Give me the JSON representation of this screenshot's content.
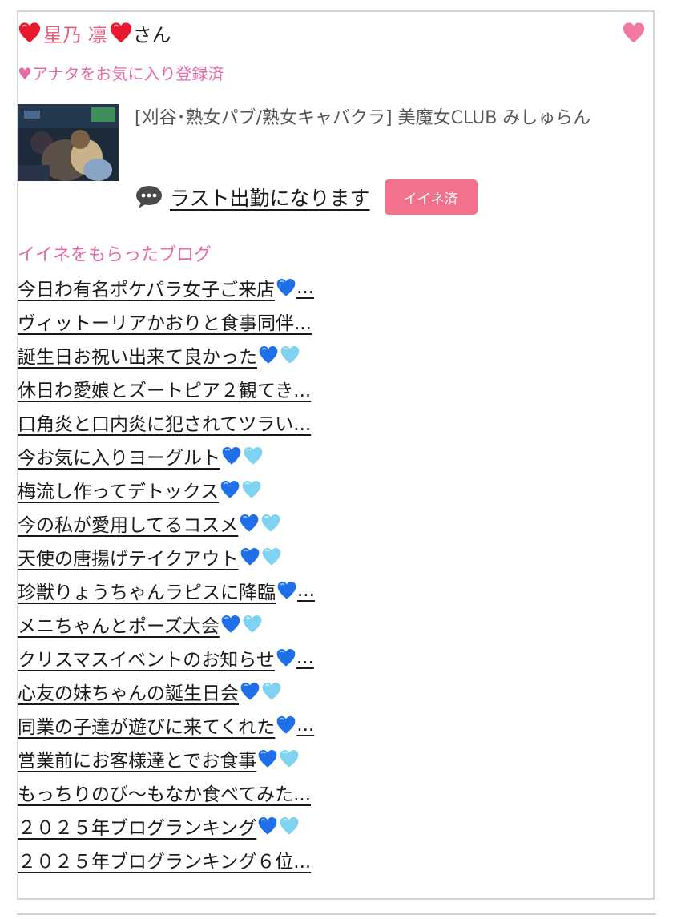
{
  "profile": {
    "name": "星乃 凛",
    "suffix": "さん",
    "favorite_status": "♥アナタをお気に入り登録済",
    "shop": "[刈谷･熟女パブ/熟女キャバクラ]  美魔女CLUB みしゅらん",
    "status_text": "ラスト出勤になります",
    "like_badge": "イイネ済"
  },
  "icons": {
    "name_heart": "red-heart-icon",
    "favorite": "pink-heart-icon",
    "comment": "speech-bubble-icon",
    "blue_heart": "blue-heart-icon",
    "light_blue_heart": "light-blue-heart-icon"
  },
  "colors": {
    "accent_pink": "#e56aa8",
    "name_pink": "#e0607e",
    "badge_bg": "#f2728c",
    "heart_red": "#e8192c",
    "heart_blue": "#1f6fe8",
    "heart_light_blue": "#7fd3f0"
  },
  "blog_heading": "イイネをもらったブログ",
  "blogs": [
    {
      "title": "今日わ有名ポケパラ女子ご来店",
      "icons": [
        "blue"
      ],
      "ellipsis": "..."
    },
    {
      "title": "ヴィットーリアかおりと食事同伴...",
      "icons": [],
      "ellipsis": ""
    },
    {
      "title": "誕生日お祝い出来て良かった",
      "icons": [
        "blue",
        "light"
      ],
      "ellipsis": ""
    },
    {
      "title": "休日わ愛娘とズートピア２観てき...",
      "icons": [],
      "ellipsis": ""
    },
    {
      "title": "口角炎と口内炎に犯されてツラい...",
      "icons": [],
      "ellipsis": ""
    },
    {
      "title": "今お気に入りヨーグルト",
      "icons": [
        "blue",
        "light"
      ],
      "ellipsis": ""
    },
    {
      "title": "梅流し作ってデトックス",
      "icons": [
        "blue",
        "light"
      ],
      "ellipsis": ""
    },
    {
      "title": "今の私が愛用してるコスメ",
      "icons": [
        "blue",
        "light"
      ],
      "ellipsis": ""
    },
    {
      "title": "天使の唐揚げテイクアウト",
      "icons": [
        "blue",
        "light"
      ],
      "ellipsis": ""
    },
    {
      "title": "珍獣りょうちゃんラピスに降臨",
      "icons": [
        "blue"
      ],
      "ellipsis": "..."
    },
    {
      "title": "メニちゃんとポーズ大会",
      "icons": [
        "blue",
        "light"
      ],
      "ellipsis": ""
    },
    {
      "title": "クリスマスイベントのお知らせ",
      "icons": [
        "blue"
      ],
      "ellipsis": "..."
    },
    {
      "title": "心友の妹ちゃんの誕生日会",
      "icons": [
        "blue",
        "light"
      ],
      "ellipsis": ""
    },
    {
      "title": "同業の子達が遊びに来てくれた",
      "icons": [
        "blue"
      ],
      "ellipsis": "..."
    },
    {
      "title": "営業前にお客様達とでお食事",
      "icons": [
        "blue",
        "light"
      ],
      "ellipsis": ""
    },
    {
      "title": "もっちりのび〜もなか食べてみた...",
      "icons": [],
      "ellipsis": ""
    },
    {
      "title": "２０２５年ブログランキング",
      "icons": [
        "blue",
        "light"
      ],
      "ellipsis": ""
    },
    {
      "title": "２０２５年ブログランキング６位...",
      "icons": [],
      "ellipsis": ""
    }
  ]
}
